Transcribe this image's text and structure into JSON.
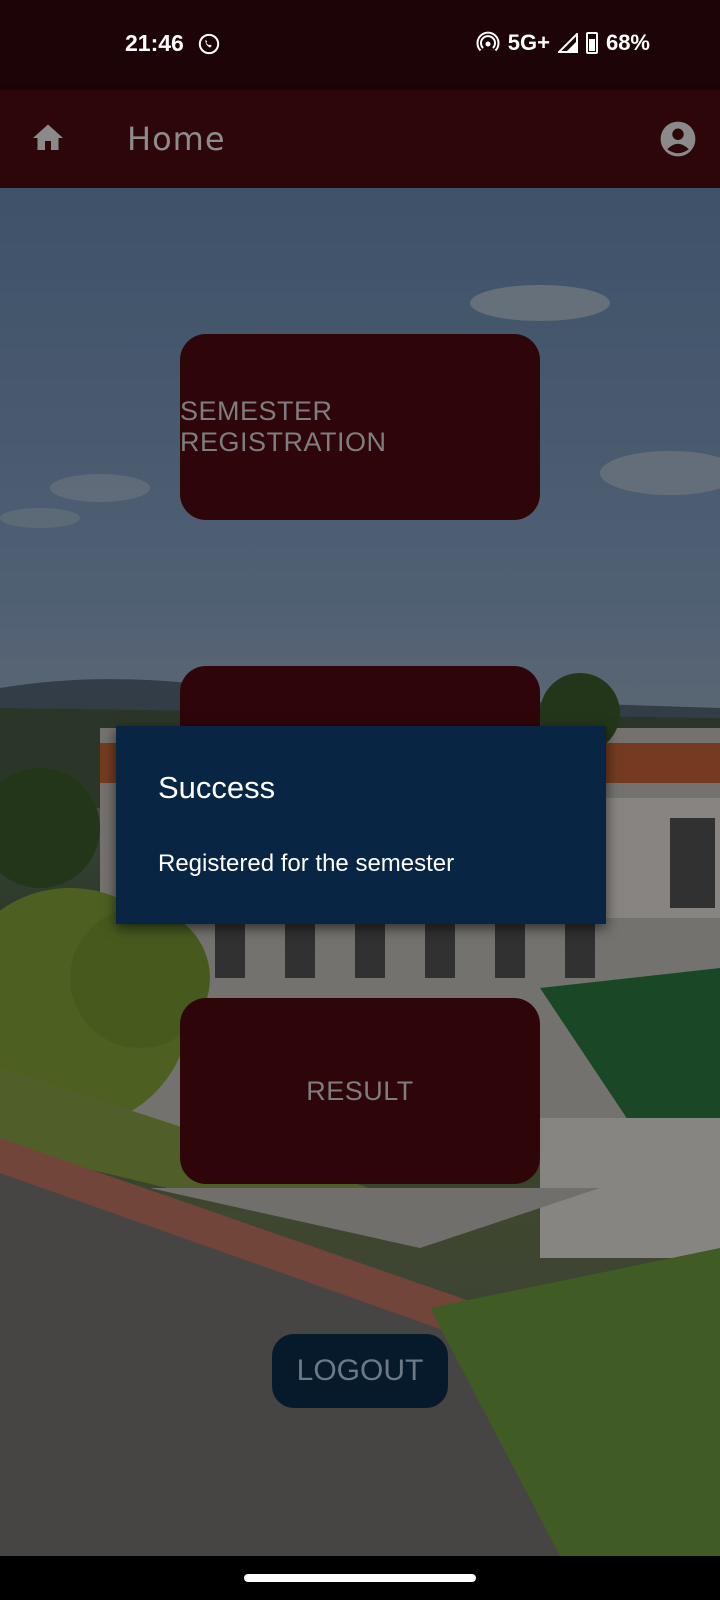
{
  "status_bar": {
    "time": "21:46",
    "network": "5G+",
    "battery": "68%",
    "icons": [
      "whatsapp-icon",
      "hotspot-icon",
      "signal-icon",
      "battery-icon"
    ]
  },
  "app_bar": {
    "title": "Home",
    "icons": [
      "home-icon",
      "account-circle-icon"
    ]
  },
  "menu": {
    "semester_registration": "SEMESTER REGISTRATION",
    "result": "RESULT",
    "logout": "LOGOUT"
  },
  "dialog": {
    "title": "Success",
    "message": "Registered for the semester"
  },
  "colors": {
    "status_bar_bg": "#1d0407",
    "app_bar_bg": "#2d0609",
    "card_bg": "#2e0609",
    "dialog_bg": "#082544",
    "logout_bg": "#071a2c"
  }
}
